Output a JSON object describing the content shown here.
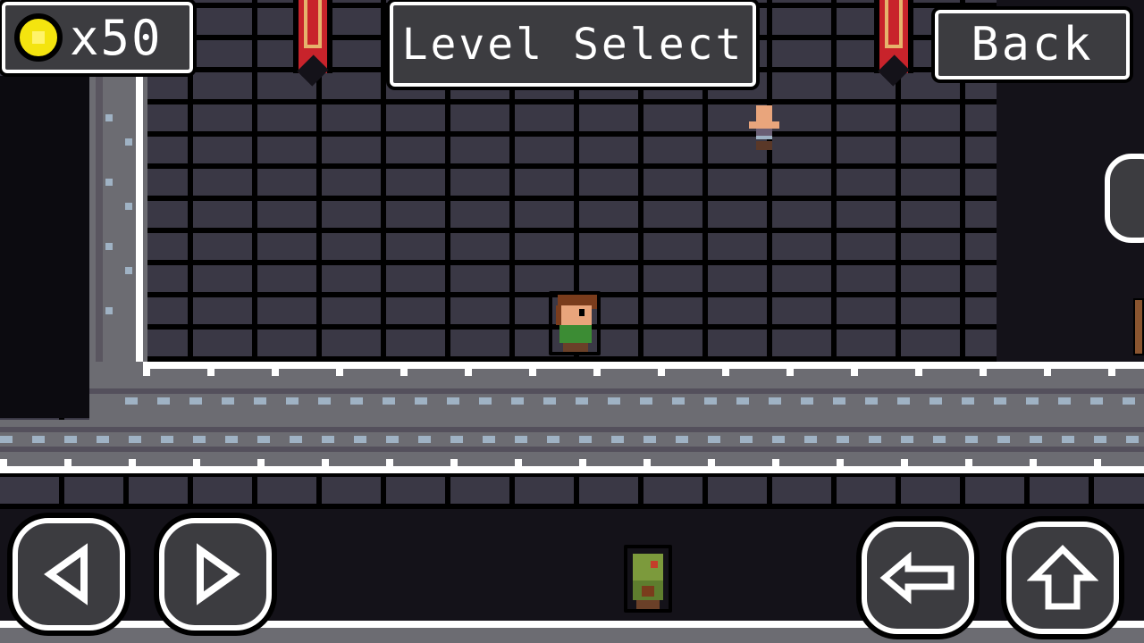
{
  "hud": {
    "coin_count": "x50",
    "coin_icon": "coin-icon",
    "title": "Level Select",
    "back_label": "Back"
  },
  "controls": {
    "move_left_icon": "arrow-left-icon",
    "move_right_icon": "arrow-right-icon",
    "action_icon": "arrow-left-outline-icon",
    "jump_icon": "arrow-up-outline-icon"
  },
  "colors": {
    "brick": "#3a3845",
    "mortar": "#000000",
    "panel": "#3c3c40",
    "frame": "#6c6c72",
    "banner": "#c8232b",
    "coin": "#f4e40f"
  }
}
